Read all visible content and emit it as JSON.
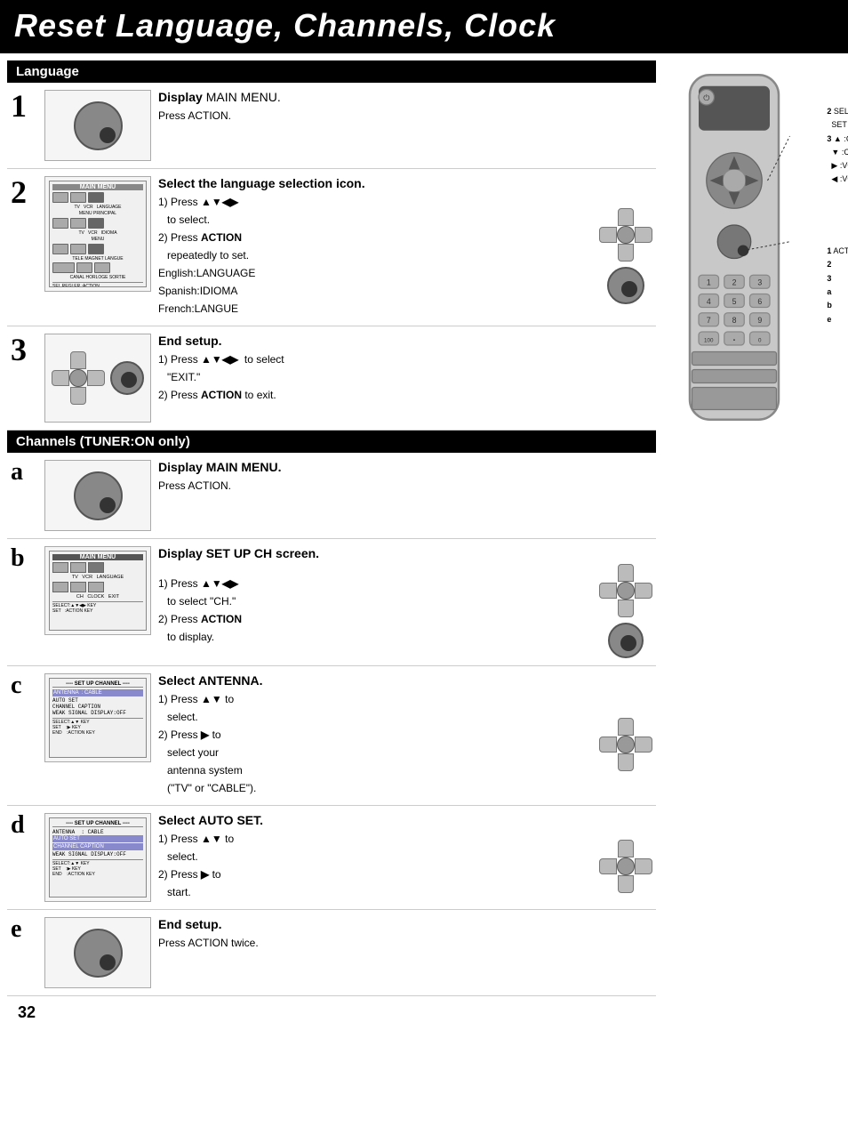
{
  "header": {
    "title": "Reset Language, Channels, Clock"
  },
  "sections": {
    "language": {
      "label": "Language",
      "steps": [
        {
          "number": "1",
          "title": "Display MAIN MENU.",
          "body": "Press ACTION."
        },
        {
          "number": "2",
          "title": "Select the language selection icon.",
          "body_lines": [
            "1) Press ▲▼◀▶ to select.",
            "2) Press ACTION repeatedly to set.",
            "English:LANGUAGE",
            "Spanish:IDIOMA",
            "French:LANGUE"
          ]
        },
        {
          "number": "3",
          "title": "End setup.",
          "body_lines": [
            "1) Press ▲▼◀▶  to select \"EXIT.\"",
            "2) Press ACTION to exit."
          ]
        }
      ]
    },
    "channels": {
      "label": "Channels (TUNER:ON only)",
      "steps": [
        {
          "number": "a",
          "title": "Display MAIN MENU.",
          "body": "Press ACTION."
        },
        {
          "number": "b",
          "title": "Display SET UP CH screen.",
          "body_lines": [
            "1) Press ▲▼◀▶ to select \"CH.\"",
            "2) Press ACTION to display."
          ]
        },
        {
          "number": "c",
          "title": "Select ANTENNA.",
          "body_lines": [
            "1) Press ▲▼ to select.",
            "2) Press ▶ to select your antenna system (\"TV\" or \"CABLE\")."
          ]
        },
        {
          "number": "d",
          "title": "Select AUTO SET.",
          "body_lines": [
            "1) Press ▲▼ to select.",
            "2) Press ▶ to start."
          ]
        },
        {
          "number": "e",
          "title": "End setup.",
          "body": "Press ACTION twice."
        }
      ]
    }
  },
  "legend": {
    "items": [
      {
        "key": "2",
        "value": "SELECT/SET"
      },
      {
        "key": "3",
        "value": "▲ :CH UP"
      },
      {
        "key": "",
        "value": "▼ :CH DOWN"
      },
      {
        "key": "",
        "value": "▶ :VOL UP"
      },
      {
        "key": "",
        "value": "◀ :VOL DOWN"
      },
      {
        "key": "1",
        "value": "ACTION"
      },
      {
        "key": "2",
        "value": ""
      },
      {
        "key": "3",
        "value": ""
      },
      {
        "key": "a",
        "value": ""
      },
      {
        "key": "b",
        "value": ""
      },
      {
        "key": "e",
        "value": ""
      }
    ]
  },
  "page_number": "32"
}
